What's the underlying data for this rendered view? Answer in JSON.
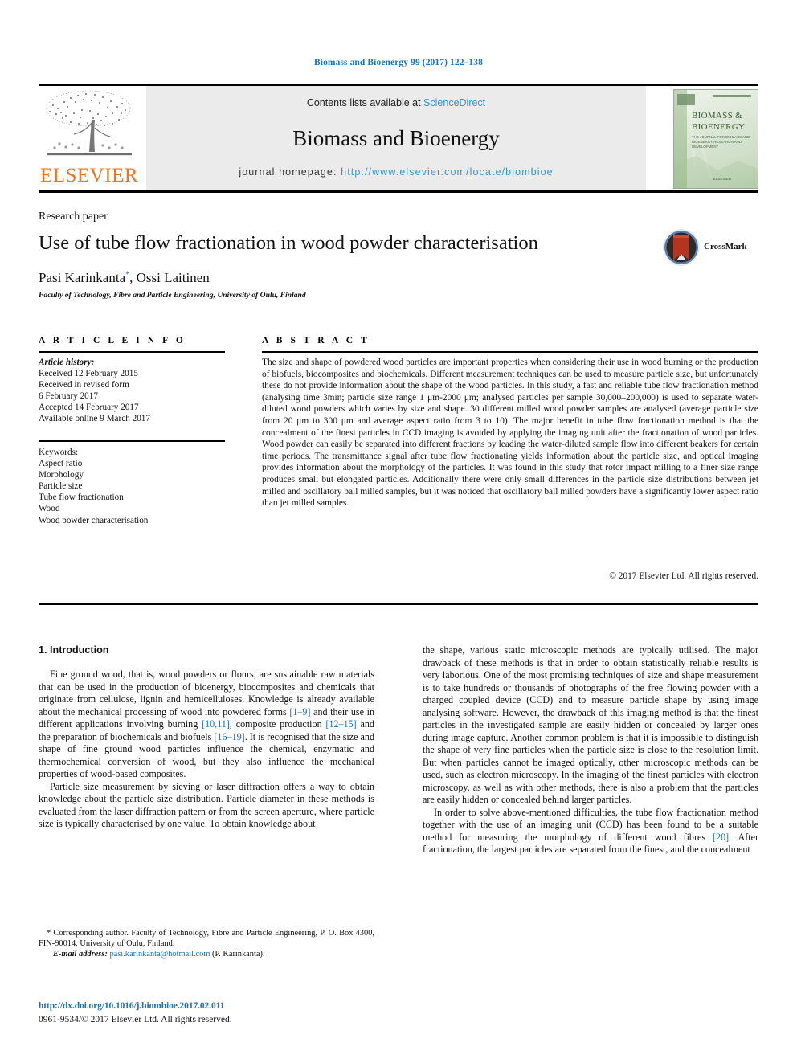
{
  "running_head": "Biomass and Bioenergy 99 (2017) 122–138",
  "masthead": {
    "publisher_name": "ELSEVIER",
    "contents_prefix": "Contents lists available at ",
    "contents_link": "ScienceDirect",
    "journal_title": "Biomass and Bioenergy",
    "homepage_prefix": "journal homepage: ",
    "homepage_url": "http://www.elsevier.com/locate/biombioe",
    "cover": {
      "line1": "BIOMASS &",
      "line2": "BIOENERGY",
      "subtitle": "THE JOURNAL FOR BIOMASS AND BIOENERGY RESEARCH AND DEVELOPMENT",
      "footer": "ELSEVIER"
    }
  },
  "article": {
    "type": "Research paper",
    "title": "Use of tube flow fractionation in wood powder characterisation",
    "authors": "Pasi Karinkanta, Ossi Laitinen",
    "author_first": "Pasi Karinkanta",
    "author_second": ", Ossi Laitinen",
    "corresponding_marker": "*",
    "affiliation": "Faculty of Technology, Fibre and Particle Engineering, University of Oulu, Finland",
    "crossmark_label": "CrossMark"
  },
  "info": {
    "heading": "A R T I C L E   I N F O",
    "history_label": "Article history:",
    "history": [
      "Received 12 February 2015",
      "Received in revised form",
      "6 February 2017",
      "Accepted 14 February 2017",
      "Available online 9 March 2017"
    ],
    "keywords_label": "Keywords:",
    "keywords": [
      "Aspect ratio",
      "Morphology",
      "Particle size",
      "Tube flow fractionation",
      "Wood",
      "Wood powder characterisation"
    ]
  },
  "abstract": {
    "heading": "A B S T R A C T",
    "text": "The size and shape of powdered wood particles are important properties when considering their use in wood burning or the production of biofuels, biocomposites and biochemicals. Different measurement techniques can be used to measure particle size, but unfortunately these do not provide information about the shape of the wood particles. In this study, a fast and reliable tube flow fractionation method (analysing time 3min; particle size range 1 μm-2000 μm; analysed particles per sample 30,000–200,000) is used to separate water-diluted wood powders which varies by size and shape. 30 different milled wood powder samples are analysed (average particle size from 20 μm to 300 μm and average aspect ratio from 3 to 10). The major benefit in tube flow fractionation method is that the concealment of the finest particles in CCD imaging is avoided by applying the imaging unit after the fractionation of wood particles. Wood powder can easily be separated into different fractions by leading the water-diluted sample flow into different beakers for certain time periods. The transmittance signal after tube flow fractionating yields information about the particle size, and optical imaging provides information about the morphology of the particles. It was found in this study that rotor impact milling to a finer size range produces small but elongated particles. Additionally there were only small differences in the particle size distributions between jet milled and oscillatory ball milled samples, but it was noticed that oscillatory ball milled powders have a significantly lower aspect ratio than jet milled samples.",
    "copyright": "© 2017 Elsevier Ltd. All rights reserved."
  },
  "body": {
    "section_heading": "1. Introduction",
    "left_p1_a": "Fine ground wood, that is, wood powders or flours, are sustainable raw materials that can be used in the production of bioenergy, biocomposites and chemicals that originate from cellulose, lignin and hemicelluloses. Knowledge is already available about the mechanical processing of wood into powdered forms ",
    "left_p1_ref1": "[1–9]",
    "left_p1_b": " and their use in different applications involving burning ",
    "left_p1_ref2": "[10,11]",
    "left_p1_c": ", composite production ",
    "left_p1_ref3": "[12–15]",
    "left_p1_d": " and the preparation of biochemicals and biofuels ",
    "left_p1_ref4": "[16–19]",
    "left_p1_e": ". It is recognised that the size and shape of fine ground wood particles influence the chemical, enzymatic and thermochemical conversion of wood, but they also influence the mechanical properties of wood-based composites.",
    "left_p2": "Particle size measurement by sieving or laser diffraction offers a way to obtain knowledge about the particle size distribution. Particle diameter in these methods is evaluated from the laser diffraction pattern or from the screen aperture, where particle size is typically characterised by one value. To obtain knowledge about",
    "right_p1": "the shape, various static microscopic methods are typically utilised. The major drawback of these methods is that in order to obtain statistically reliable results is very laborious. One of the most promising techniques of size and shape measurement is to take hundreds or thousands of photographs of the free flowing powder with a charged coupled device (CCD) and to measure particle shape by using image analysing software. However, the drawback of this imaging method is that the finest particles in the investigated sample are easily hidden or concealed by larger ones during image capture. Another common problem is that it is impossible to distinguish the shape of very fine particles when the particle size is close to the resolution limit. But when particles cannot be imaged optically, other microscopic methods can be used, such as electron microscopy. In the imaging of the finest particles with electron microscopy, as well as with other methods, there is also a problem that the particles are easily hidden or concealed behind larger particles.",
    "right_p2_a": "In order to solve above-mentioned difficulties, the tube flow fractionation method together with the use of an imaging unit (CCD) has been found to be a suitable method for measuring the morphology of different wood fibres ",
    "right_p2_ref": "[20]",
    "right_p2_b": ". After fractionation, the largest particles are separated from the finest, and the concealment"
  },
  "footer": {
    "corresponding_marker": "*",
    "corresponding_text": " Corresponding author. Faculty of Technology, Fibre and Particle Engineering, P. O. Box 4300, FIN-90014, University of Oulu, Finland.",
    "email_label": "E-mail address:",
    "email": "pasi.karinkanta@hotmail.com",
    "email_suffix": " (P. Karinkanta).",
    "doi": "http://dx.doi.org/10.1016/j.biombioe.2017.02.011",
    "issn": "0961-9534/© 2017 Elsevier Ltd. All rights reserved."
  },
  "colors": {
    "link_blue": "#1a72b8",
    "sd_blue": "#3a93c9",
    "elsevier_orange": "#e87722",
    "masthead_grey": "#ebebeb"
  }
}
